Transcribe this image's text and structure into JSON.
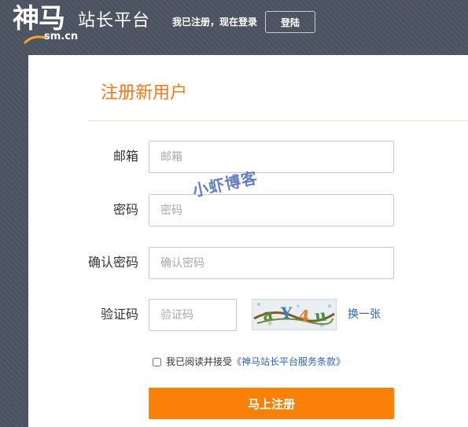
{
  "header": {
    "logo_chars": "神马",
    "logo_sub": "sm.cn",
    "site_name": "站长平台",
    "login_prompt": "我已注册，现在登录",
    "login_button": "登陆"
  },
  "form": {
    "title": "注册新用户",
    "fields": [
      {
        "label": "邮箱",
        "placeholder": "邮箱",
        "value": ""
      },
      {
        "label": "密码",
        "placeholder": "密码",
        "value": ""
      },
      {
        "label": "确认密码",
        "placeholder": "确认密码",
        "value": ""
      },
      {
        "label": "验证码",
        "placeholder": "验证码",
        "value": ""
      }
    ],
    "captcha_text": "aY4u",
    "captcha_refresh": "换一张",
    "agree_text": "我已阅读并接受",
    "terms_link": "《神马站长平台服务条款》",
    "agree_checked": false,
    "submit": "马上注册"
  },
  "watermark": "小虾博客",
  "colors": {
    "accent": "#fb8008",
    "title": "#f07a1f",
    "link": "#2d64b3",
    "topbar": "#4b5260"
  }
}
